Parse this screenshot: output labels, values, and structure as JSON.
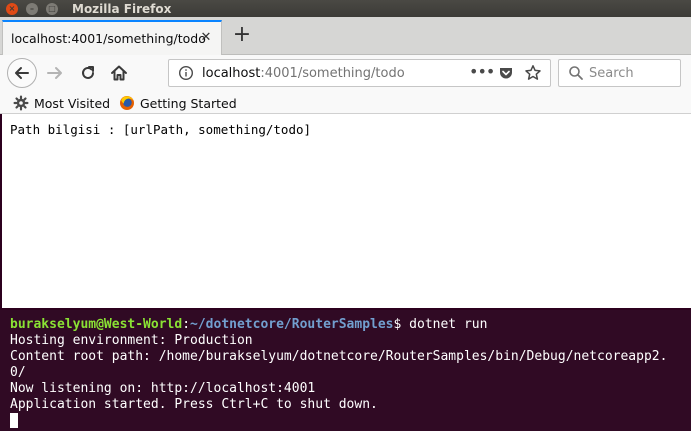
{
  "window": {
    "title": "Mozilla Firefox"
  },
  "tab": {
    "label": "localhost:4001/something/todo"
  },
  "address": {
    "host": "localhost",
    "rest": ":4001/something/todo"
  },
  "search": {
    "placeholder": "Search"
  },
  "bookmarks": [
    {
      "label": "Most Visited",
      "icon": "gear-icon"
    },
    {
      "label": "Getting Started",
      "icon": "firefox-icon"
    }
  ],
  "page": {
    "text": "Path bilgisi : [urlPath, something/todo]"
  },
  "terminal": {
    "prompt_user": "burakselyum@West-World",
    "prompt_sep": ":",
    "prompt_path": "~/dotnetcore/RouterSamples",
    "prompt_symbol": "$ ",
    "command": "dotnet run",
    "output": [
      "Hosting environment: Production",
      "Content root path: /home/burakselyum/dotnetcore/RouterSamples/bin/Debug/netcoreapp2.",
      "0/",
      "Now listening on: http://localhost:4001",
      "Application started. Press Ctrl+C to shut down."
    ]
  },
  "colors": {
    "titlebar": "#3c3b37",
    "tab_accent": "#0a84ff",
    "terminal_bg": "#300a24",
    "prompt_user": "#8ae234",
    "prompt_path": "#729fcf"
  }
}
